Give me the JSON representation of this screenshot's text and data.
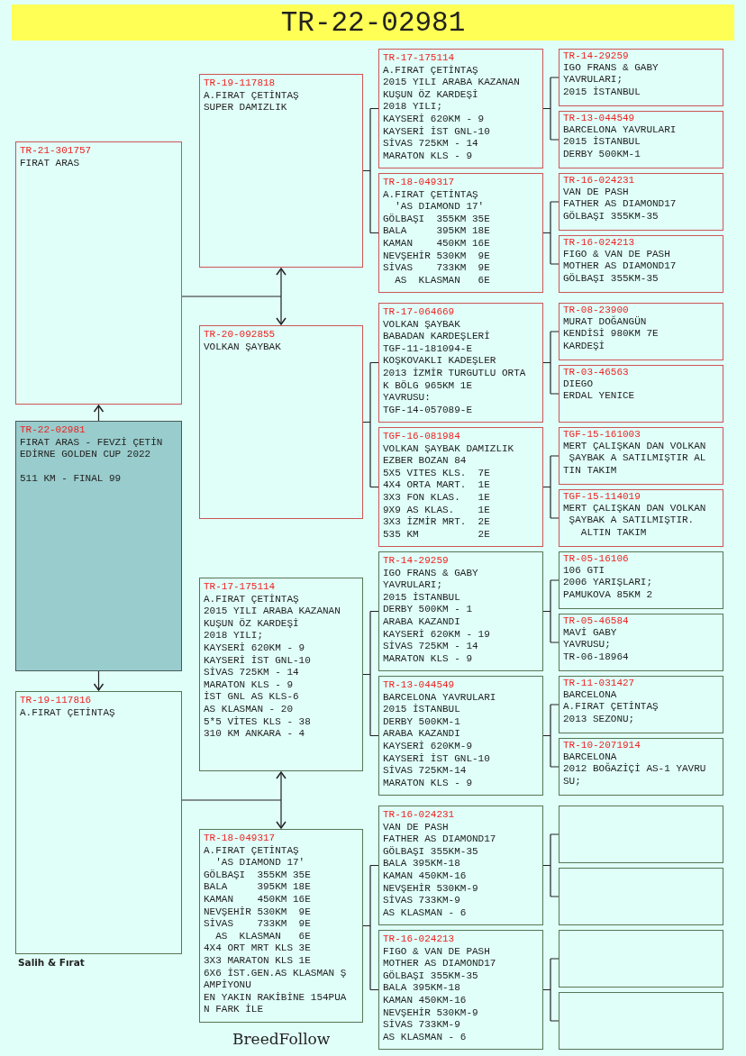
{
  "title": "TR-22-02981",
  "subject": {
    "ring": "TR-22-02981",
    "kind": "subject",
    "lines": [
      "FIRAT ARAS - FEVZİ ÇETİN",
      "EDİRNE GOLDEN CUP 2022"
    ],
    "note": "511 KM - FINAL 99",
    "parents": [
      {
        "ring": "TR-21-301757",
        "kind": "paternal",
        "lines": [
          "FIRAT ARAS"
        ],
        "parents": [
          {
            "ring": "TR-19-117818",
            "kind": "paternal",
            "lines": [
              "A.FIRAT ÇETİNTAŞ",
              "SUPER DAMIZLIK"
            ],
            "parents": [
              {
                "ring": "TR-17-175114",
                "kind": "paternal",
                "lines": [
                  "A.FIRAT ÇETİNTAŞ",
                  "2015 YILI ARABA KAZANAN",
                  "KUŞUN ÖZ KARDEŞİ",
                  "2018 YILI;",
                  "KAYSERİ 620KM - 9",
                  "KAYSERİ İST GNL-10",
                  "SİVAS 725KM - 14",
                  "MARATON KLS - 9"
                ],
                "parents": [
                  {
                    "ring": "TR-14-29259",
                    "kind": "paternal",
                    "lines": [
                      "IGO FRANS & GABY",
                      "YAVRULARI;",
                      "2015 İSTANBUL"
                    ]
                  },
                  {
                    "ring": "TR-13-044549",
                    "kind": "paternal",
                    "lines": [
                      "BARCELONA YAVRULARI",
                      "2015 İSTANBUL",
                      "DERBY 500KM-1"
                    ]
                  }
                ]
              },
              {
                "ring": "TR-18-049317",
                "kind": "paternal",
                "lines": [
                  "A.FIRAT ÇETİNTAŞ",
                  "  'AS DIAMOND 17'",
                  "GÖLBAŞI  355KM 35E",
                  "BALA     395KM 18E",
                  "KAMAN    450KM 16E",
                  "NEVŞEHİR 530KM  9E",
                  "SİVAS    733KM  9E",
                  "  AS  KLASMAN   6E"
                ],
                "parents": [
                  {
                    "ring": "TR-16-024231",
                    "kind": "paternal",
                    "lines": [
                      "VAN DE PASH",
                      "FATHER AS DIAMOND17",
                      "GÖLBAŞI 355KM-35"
                    ]
                  },
                  {
                    "ring": "TR-16-024213",
                    "kind": "paternal",
                    "lines": [
                      "FIGO & VAN DE PASH",
                      "MOTHER AS DIAMOND17",
                      "GÖLBAŞI 355KM-35"
                    ]
                  }
                ]
              }
            ]
          },
          {
            "ring": "TR-20-092855",
            "kind": "paternal",
            "lines": [
              "VOLKAN ŞAYBAK"
            ],
            "parents": [
              {
                "ring": "TR-17-064669",
                "kind": "paternal",
                "lines": [
                  "VOLKAN ŞAYBAK",
                  "BABADAN KARDEŞLERİ",
                  "TGF-11-181094-E",
                  "KOŞKOVAKLI KADEŞLER",
                  "2013 İZMİR TURGUTLU ORTA",
                  "K BÖLG 965KM 1E",
                  "YAVRUSU:",
                  "TGF-14-057089-E"
                ],
                "parents": [
                  {
                    "ring": "TR-08-23900",
                    "kind": "paternal",
                    "lines": [
                      "MURAT DOĞANGÜN",
                      "KENDİSİ 980KM 7E",
                      "KARDEŞİ"
                    ]
                  },
                  {
                    "ring": "TR-03-46563",
                    "kind": "paternal",
                    "lines": [
                      "DIEGO",
                      "ERDAL YENICE"
                    ]
                  }
                ]
              },
              {
                "ring": "TGF-16-081984",
                "kind": "paternal",
                "lines": [
                  "VOLKAN ŞAYBAK DAMIZLIK",
                  "EZBER BOZAN 84",
                  "5X5 VITES KLS.  7E",
                  "4X4 ORTA MART.  1E",
                  "3X3 FON KLAS.   1E",
                  "9X9 AS KLAS.    1E",
                  "3X3 İZMİR MRT.  2E",
                  "535 KM          2E"
                ],
                "parents": [
                  {
                    "ring": "TGF-15-161003",
                    "kind": "paternal",
                    "lines": [
                      "MERT ÇALIŞKAN DAN VOLKAN",
                      " ŞAYBAK A SATILMIŞTIR AL",
                      "TIN TAKIM"
                    ]
                  },
                  {
                    "ring": "TGF-15-114019",
                    "kind": "paternal",
                    "lines": [
                      "MERT ÇALIŞKAN DAN VOLKAN",
                      " ŞAYBAK A SATILMIŞTIR.",
                      "   ALTIN TAKIM"
                    ]
                  }
                ]
              }
            ]
          }
        ]
      },
      {
        "ring": "TR-19-117816",
        "kind": "maternal",
        "lines": [
          "A.FIRAT ÇETİNTAŞ"
        ],
        "parents": [
          {
            "ring": "TR-17-175114",
            "kind": "maternal",
            "lines": [
              "A.FIRAT ÇETİNTAŞ",
              "2015 YILI ARABA KAZANAN",
              "KUŞUN ÖZ KARDEŞİ",
              "2018 YILI;",
              "KAYSERİ 620KM - 9",
              "KAYSERİ İST GNL-10",
              "SİVAS 725KM - 14",
              "MARATON KLS - 9",
              "İST GNL AS KLS-6",
              "AS KLASMAN - 20",
              "5*5 VİTES KLS - 38",
              "310 KM ANKARA - 4"
            ],
            "parents": [
              {
                "ring": "TR-14-29259",
                "kind": "maternal",
                "lines": [
                  "IGO FRANS & GABY",
                  "YAVRULARI;",
                  "2015 İSTANBUL",
                  "DERBY 500KM - 1",
                  "ARABA KAZANDI",
                  "KAYSERİ 620KM - 19",
                  "SİVAS 725KM - 14",
                  "MARATON KLS - 9"
                ],
                "parents": [
                  {
                    "ring": "TR-05-16106",
                    "kind": "maternal",
                    "lines": [
                      "106 GTI",
                      "2006 YARIŞLARI;",
                      "PAMUKOVA 85KM 2"
                    ]
                  },
                  {
                    "ring": "TR-05-46584",
                    "kind": "maternal",
                    "lines": [
                      "MAVİ GABY",
                      "YAVRUSU;",
                      "TR-06-18964"
                    ]
                  }
                ]
              },
              {
                "ring": "TR-13-044549",
                "kind": "maternal",
                "lines": [
                  "BARCELONA YAVRULARI",
                  "2015 İSTANBUL",
                  "DERBY 500KM-1",
                  "ARABA KAZANDI",
                  "KAYSERİ 620KM-9",
                  "KAYSERİ İST GNL-10",
                  "SİVAS 725KM-14",
                  "MARATON KLS - 9"
                ],
                "parents": [
                  {
                    "ring": "TR-11-031427",
                    "kind": "maternal",
                    "lines": [
                      "BARCELONA",
                      "A.FIRAT ÇETİNTAŞ",
                      "2013 SEZONU;"
                    ]
                  },
                  {
                    "ring": "TR-10-2071914",
                    "kind": "maternal",
                    "lines": [
                      "BARCELONA",
                      "2012 BOĞAZİÇİ AS-1 YAVRU",
                      "SU;"
                    ]
                  }
                ]
              }
            ]
          },
          {
            "ring": "TR-18-049317",
            "kind": "maternal",
            "lines": [
              "A.FIRAT ÇETİNTAŞ",
              "  'AS DIAMOND 17'",
              "GÖLBAŞI  355KM 35E",
              "BALA     395KM 18E",
              "KAMAN    450KM 16E",
              "NEVŞEHİR 530KM  9E",
              "SİVAS    733KM  9E",
              "  AS  KLASMAN   6E",
              "4X4 ORT MRT KLS 3E",
              "3X3 MARATON KLS 1E",
              "6X6 İST.GEN.AS KLASMAN Ş",
              "AMPİYONU",
              "EN YAKIN RAKİBİNE 154PUA",
              "N FARK İLE"
            ],
            "parents": [
              {
                "ring": "TR-16-024231",
                "kind": "maternal",
                "lines": [
                  "VAN DE PASH",
                  "FATHER AS DIAMOND17",
                  "GÖLBAŞI 355KM-35",
                  "BALA 395KM-18",
                  "KAMAN 450KM-16",
                  "NEVŞEHİR 530KM-9",
                  "SİVAS 733KM-9",
                  "AS KLASMAN - 6"
                ],
                "parents": [
                  {
                    "kind": "maternal"
                  },
                  {
                    "kind": "maternal"
                  }
                ]
              },
              {
                "ring": "TR-16-024213",
                "kind": "maternal",
                "lines": [
                  "FIGO & VAN DE PASH",
                  "MOTHER AS DIAMOND17",
                  "GÖLBAŞI 355KM-35",
                  "BALA 395KM-18",
                  "KAMAN 450KM-16",
                  "NEVŞEHİR 530KM-9",
                  "SİVAS 733KM-9",
                  "AS KLASMAN - 6"
                ],
                "parents": [
                  {
                    "kind": "maternal"
                  },
                  {
                    "kind": "maternal"
                  }
                ]
              }
            ]
          }
        ]
      }
    ]
  },
  "signature": "Salih & Fırat",
  "footer": "BreedFollow"
}
